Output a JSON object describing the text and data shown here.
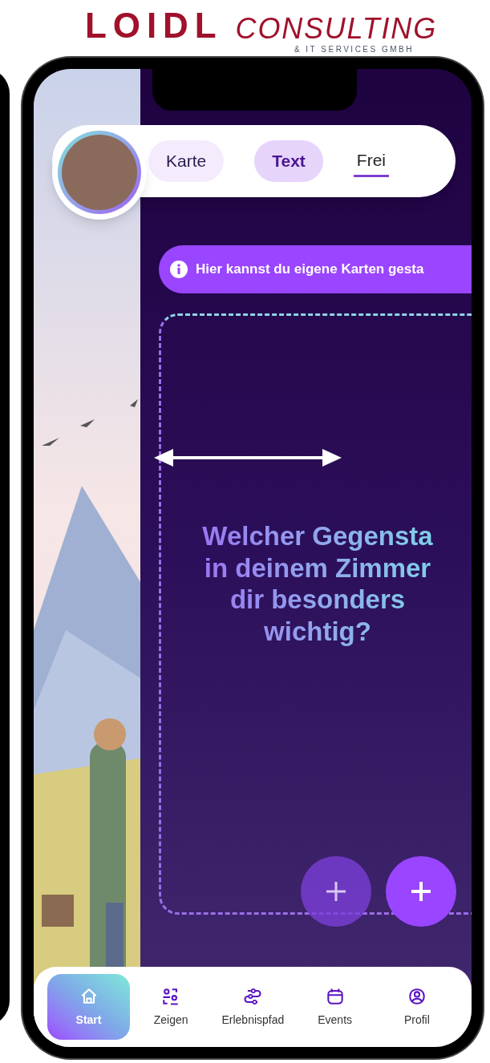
{
  "logo": {
    "name": "LOIDL",
    "suffix": "CONSULTING",
    "tagline": "& IT SERVICES GMBH"
  },
  "header": {
    "tabs": [
      {
        "label": "Karte",
        "kind": "pill",
        "selected": false
      },
      {
        "label": "Text",
        "kind": "pill",
        "selected": true
      },
      {
        "label": "Frei",
        "kind": "underlined",
        "selected": false
      }
    ]
  },
  "info_banner": {
    "text": "Hier kannst du eigene Karten gesta"
  },
  "card": {
    "question": "Welcher Gegensta\nin deinem Zimmer\ndir besonders\nwichtig?"
  },
  "nav": [
    {
      "label": "Start",
      "selected": true
    },
    {
      "label": "Zeigen",
      "selected": false
    },
    {
      "label": "Erlebnispfad",
      "selected": false
    },
    {
      "label": "Events",
      "selected": false
    },
    {
      "label": "Profil",
      "selected": false
    }
  ]
}
